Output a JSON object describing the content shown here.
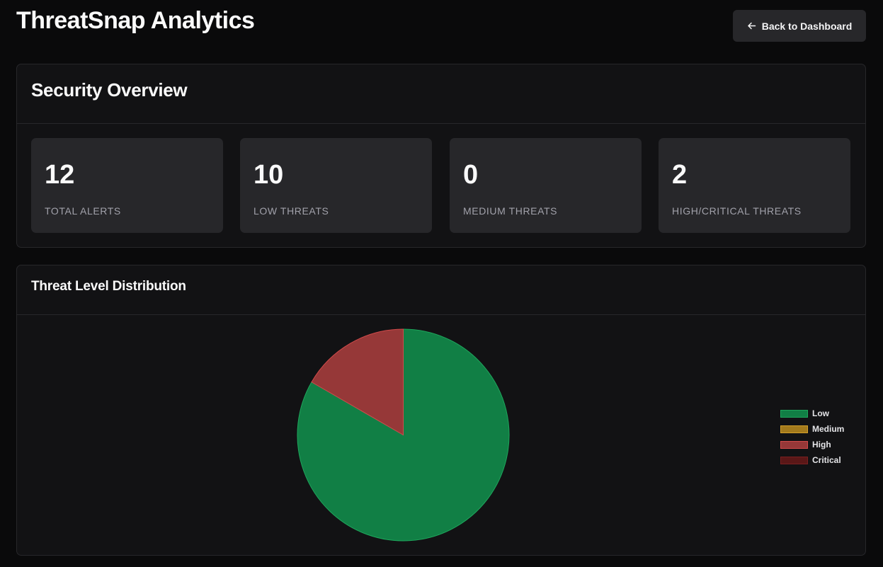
{
  "header": {
    "title": "ThreatSnap Analytics",
    "back_label": "Back to Dashboard"
  },
  "overview": {
    "title": "Security Overview",
    "stats": [
      {
        "value": "12",
        "label": "TOTAL ALERTS"
      },
      {
        "value": "10",
        "label": "LOW THREATS"
      },
      {
        "value": "0",
        "label": "MEDIUM THREATS"
      },
      {
        "value": "2",
        "label": "HIGH/CRITICAL THREATS"
      }
    ]
  },
  "distribution": {
    "title": "Threat Level Distribution"
  },
  "chart_data": {
    "type": "pie",
    "categories": [
      "Low",
      "Medium",
      "High",
      "Critical"
    ],
    "values": [
      10,
      0,
      2,
      0
    ],
    "colors": [
      "#117f45",
      "#a37a1c",
      "#963838",
      "#5a1717"
    ],
    "border_colors": [
      "#1ea65c",
      "#d4a02a",
      "#d14a4a",
      "#7a2020"
    ],
    "legend_position": "right"
  }
}
